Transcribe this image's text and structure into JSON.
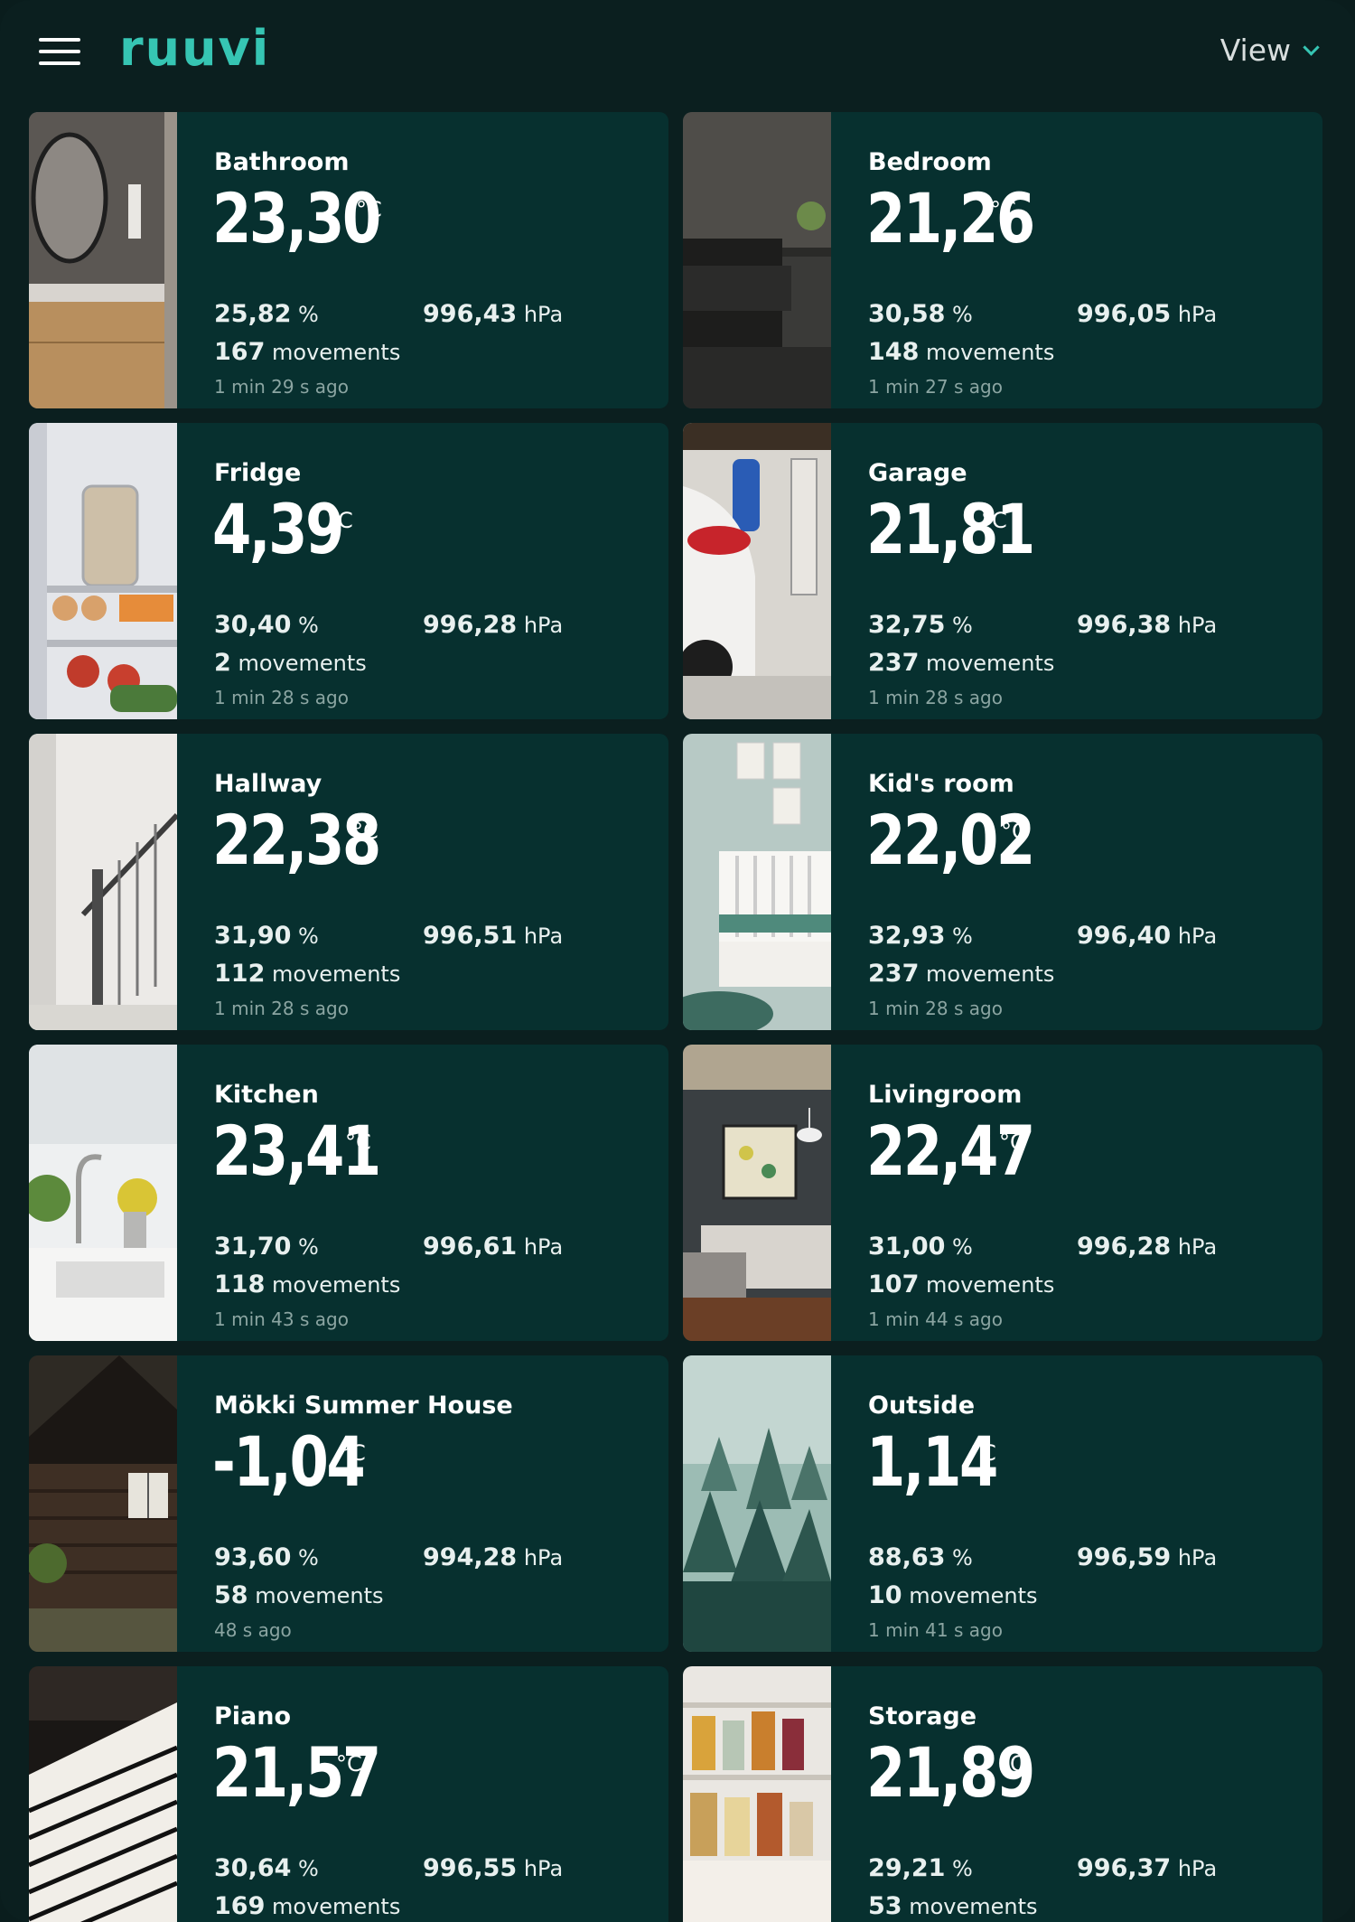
{
  "header": {
    "logo_text": "ruuvi",
    "view_label": "View"
  },
  "sensors": [
    {
      "name": "Bathroom",
      "temperature": "23,30",
      "unit": "°C",
      "humidity": "25,82",
      "humidity_unit": "%",
      "pressure": "996,43",
      "pressure_unit": "hPa",
      "movements": "167",
      "movements_label": "movements",
      "updated": "1 min 29 s ago"
    },
    {
      "name": "Bedroom",
      "temperature": "21,26",
      "unit": "°C",
      "humidity": "30,58",
      "humidity_unit": "%",
      "pressure": "996,05",
      "pressure_unit": "hPa",
      "movements": "148",
      "movements_label": "movements",
      "updated": "1 min 27 s ago"
    },
    {
      "name": "Fridge",
      "temperature": "4,39",
      "unit": "°C",
      "humidity": "30,40",
      "humidity_unit": "%",
      "pressure": "996,28",
      "pressure_unit": "hPa",
      "movements": "2",
      "movements_label": "movements",
      "updated": "1 min 28 s ago"
    },
    {
      "name": "Garage",
      "temperature": "21,81",
      "unit": "°C",
      "humidity": "32,75",
      "humidity_unit": "%",
      "pressure": "996,38",
      "pressure_unit": "hPa",
      "movements": "237",
      "movements_label": "movements",
      "updated": "1 min 28 s ago"
    },
    {
      "name": "Hallway",
      "temperature": "22,38",
      "unit": "°C",
      "humidity": "31,90",
      "humidity_unit": "%",
      "pressure": "996,51",
      "pressure_unit": "hPa",
      "movements": "112",
      "movements_label": "movements",
      "updated": "1 min 28 s ago"
    },
    {
      "name": "Kid's room",
      "temperature": "22,02",
      "unit": "°C",
      "humidity": "32,93",
      "humidity_unit": "%",
      "pressure": "996,40",
      "pressure_unit": "hPa",
      "movements": "237",
      "movements_label": "movements",
      "updated": "1 min 28 s ago"
    },
    {
      "name": "Kitchen",
      "temperature": "23,41",
      "unit": "°C",
      "humidity": "31,70",
      "humidity_unit": "%",
      "pressure": "996,61",
      "pressure_unit": "hPa",
      "movements": "118",
      "movements_label": "movements",
      "updated": "1 min 43 s ago"
    },
    {
      "name": "Livingroom",
      "temperature": "22,47",
      "unit": "°C",
      "humidity": "31,00",
      "humidity_unit": "%",
      "pressure": "996,28",
      "pressure_unit": "hPa",
      "movements": "107",
      "movements_label": "movements",
      "updated": "1 min 44 s ago"
    },
    {
      "name": "Mökki Summer House",
      "temperature": "-1,04",
      "unit": "°C",
      "humidity": "93,60",
      "humidity_unit": "%",
      "pressure": "994,28",
      "pressure_unit": "hPa",
      "movements": "58",
      "movements_label": "movements",
      "updated": "48 s ago"
    },
    {
      "name": "Outside",
      "temperature": "1,14",
      "unit": "°C",
      "humidity": "88,63",
      "humidity_unit": "%",
      "pressure": "996,59",
      "pressure_unit": "hPa",
      "movements": "10",
      "movements_label": "movements",
      "updated": "1 min 41 s ago"
    },
    {
      "name": "Piano",
      "temperature": "21,57",
      "unit": "°C",
      "humidity": "30,64",
      "humidity_unit": "%",
      "pressure": "996,55",
      "pressure_unit": "hPa",
      "movements": "169",
      "movements_label": "movements",
      "updated": ""
    },
    {
      "name": "Storage",
      "temperature": "21,89",
      "unit": "°C",
      "humidity": "29,21",
      "humidity_unit": "%",
      "pressure": "996,37",
      "pressure_unit": "hPa",
      "movements": "53",
      "movements_label": "movements",
      "updated": ""
    }
  ],
  "colors": {
    "background": "#0b1f1f",
    "card": "#07302f",
    "accent": "#36c5b3",
    "muted_text": "#8ba5a2"
  }
}
